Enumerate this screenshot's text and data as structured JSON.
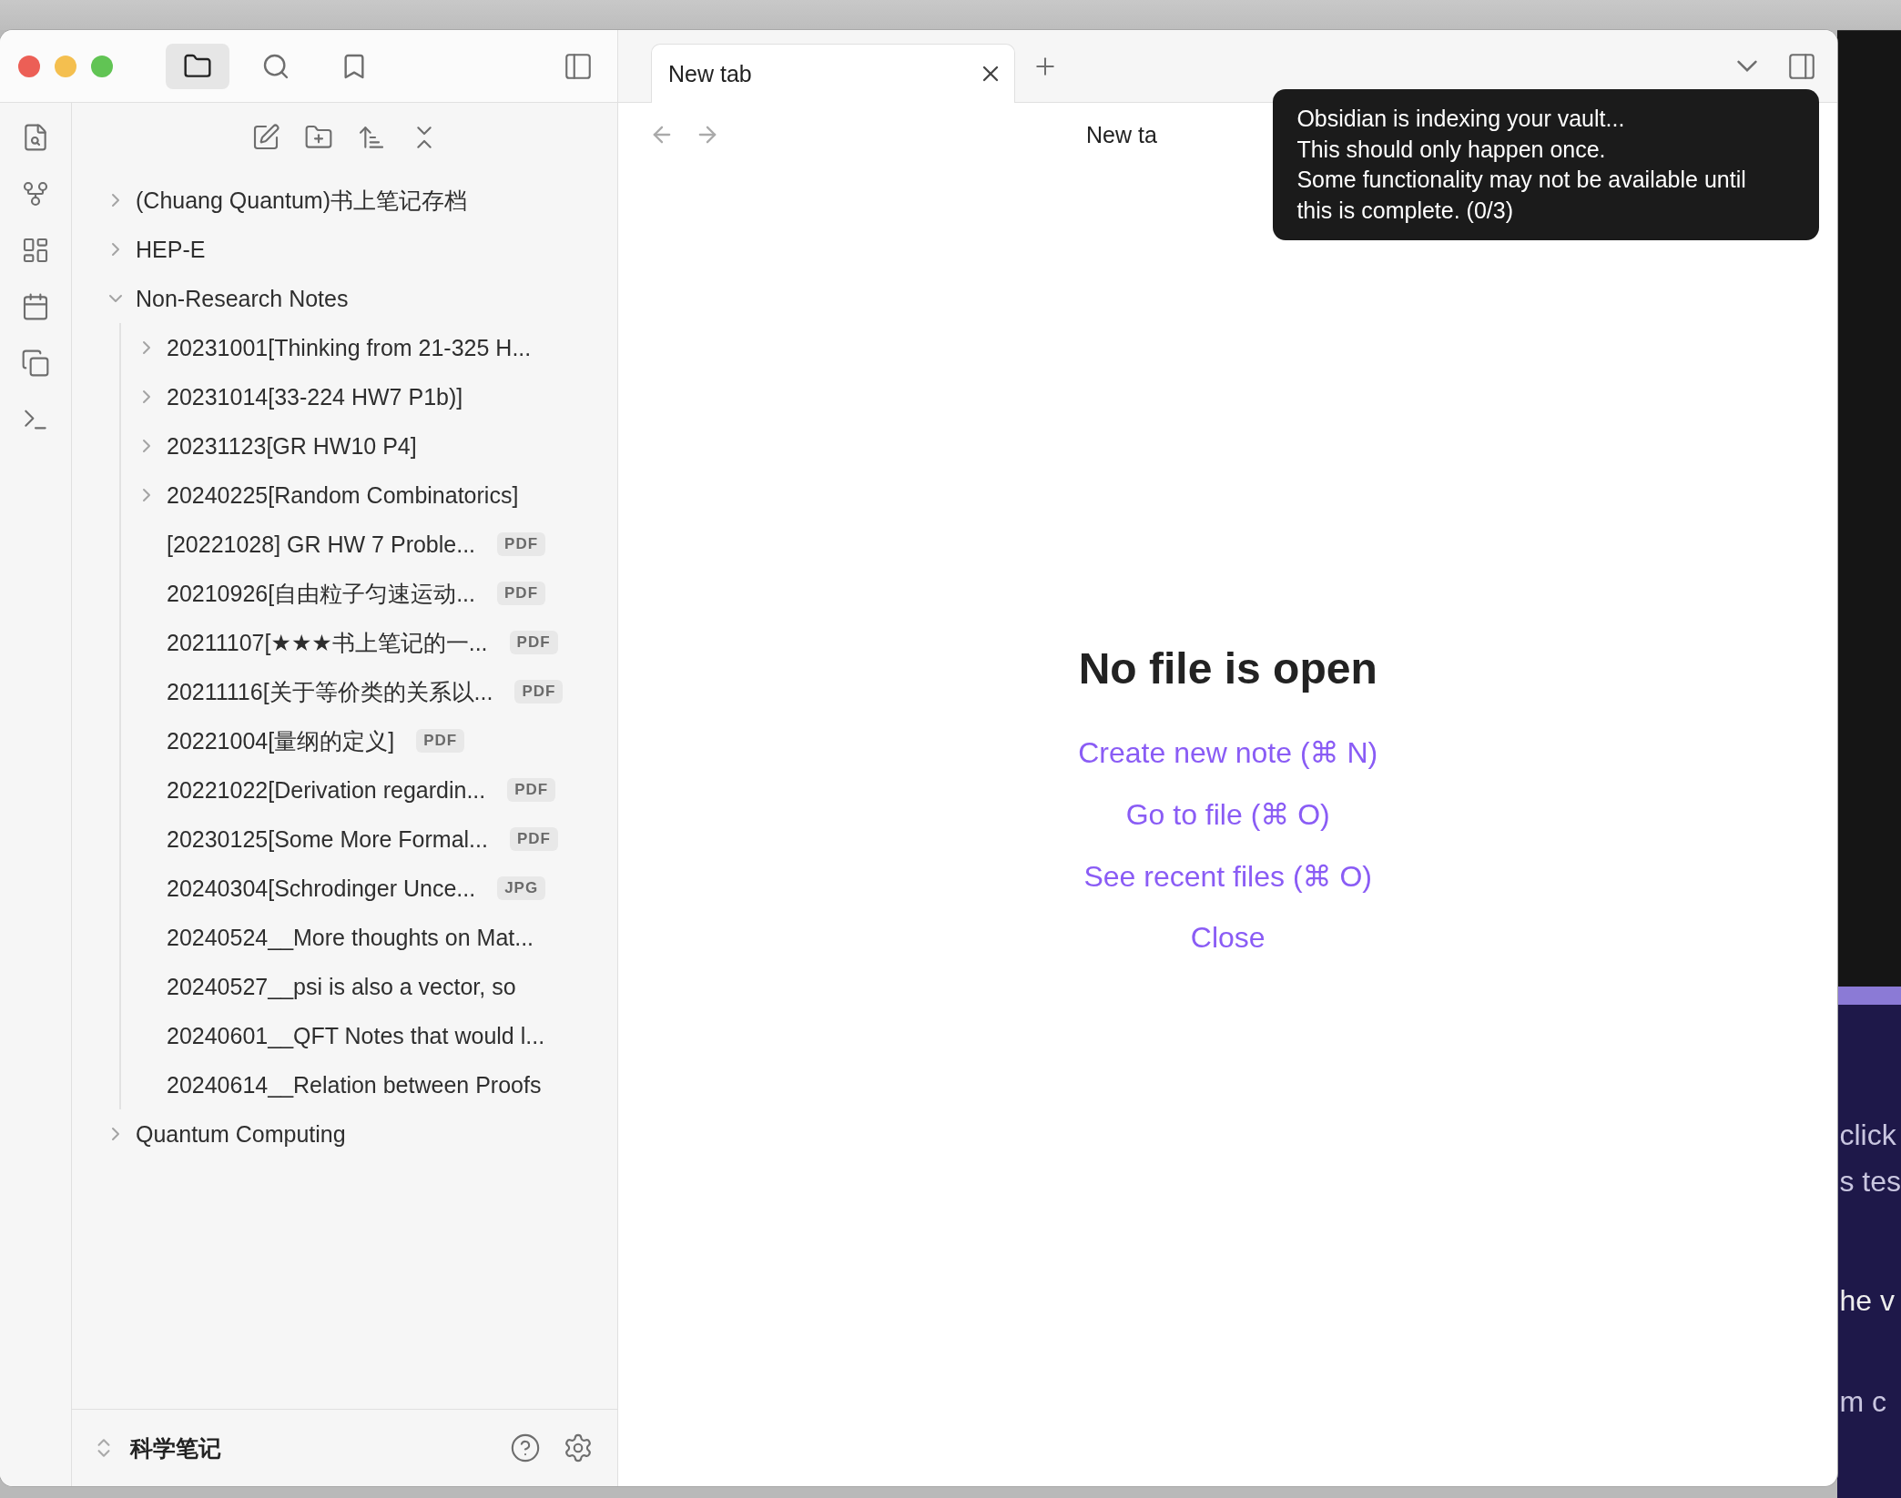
{
  "sidebar_tabs": [
    {
      "kind": "files",
      "selected": true
    },
    {
      "kind": "search",
      "selected": false
    },
    {
      "kind": "bookmarks",
      "selected": false
    }
  ],
  "file_tree": [
    {
      "label": "(Chuang Quantum)书上笔记存档",
      "kind": "folder",
      "expanded": false
    },
    {
      "label": "HEP-E",
      "kind": "folder",
      "expanded": false
    },
    {
      "label": "Non-Research Notes",
      "kind": "folder",
      "expanded": true,
      "children": [
        {
          "label": "20231001[Thinking from 21-325 H...",
          "kind": "folder",
          "expanded": false
        },
        {
          "label": "20231014[33-224 HW7 P1b)]",
          "kind": "folder",
          "expanded": false
        },
        {
          "label": "20231123[GR HW10 P4]",
          "kind": "folder",
          "expanded": false
        },
        {
          "label": "20240225[Random Combinatorics]",
          "kind": "folder",
          "expanded": false
        },
        {
          "label": "[20221028] GR HW 7 Proble...",
          "kind": "file",
          "badge": "PDF"
        },
        {
          "label": "20210926[自由粒子匀速运动...",
          "kind": "file",
          "badge": "PDF"
        },
        {
          "label": "20211107[★★★书上笔记的一...",
          "kind": "file",
          "badge": "PDF"
        },
        {
          "label": "20211116[关于等价类的关系以...",
          "kind": "file",
          "badge": "PDF"
        },
        {
          "label": "20221004[量纲的定义]",
          "kind": "file",
          "badge": "PDF"
        },
        {
          "label": "20221022[Derivation regardin...",
          "kind": "file",
          "badge": "PDF"
        },
        {
          "label": "20230125[Some More Formal...",
          "kind": "file",
          "badge": "PDF"
        },
        {
          "label": "20240304[Schrodinger Unce...",
          "kind": "file",
          "badge": "JPG"
        },
        {
          "label": "20240524__More thoughts on Mat...",
          "kind": "file"
        },
        {
          "label": "20240527__psi is also a vector, so",
          "kind": "file"
        },
        {
          "label": "20240601__QFT Notes that would l...",
          "kind": "file"
        },
        {
          "label": "20240614__Relation between Proofs",
          "kind": "file"
        }
      ]
    },
    {
      "label": "Quantum Computing",
      "kind": "folder",
      "expanded": false
    }
  ],
  "vault": {
    "name": "科学笔记"
  },
  "tabs": [
    {
      "title": "New tab",
      "selected": true
    }
  ],
  "view_header": {
    "title": "New ta"
  },
  "empty_state": {
    "title": "No file is open",
    "actions": [
      "Create new note (⌘ N)",
      "Go to file (⌘ O)",
      "See recent files (⌘ O)",
      "Close"
    ]
  },
  "notice": {
    "text": "Obsidian is indexing your vault...\nThis should only happen once.\nSome functionality may not be available until\nthis is complete. (0/3)"
  },
  "background_window": {
    "texts": [
      "click",
      "s tes",
      "he v",
      "m c"
    ]
  }
}
